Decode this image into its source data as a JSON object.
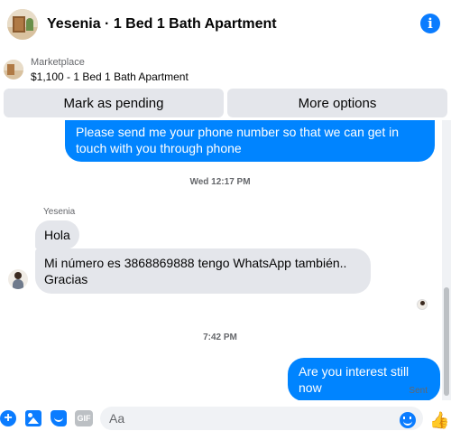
{
  "header": {
    "title": "Yesenia · 1 Bed 1 Bath Apartment",
    "info_icon": "info-icon",
    "accent": "#0a7cff"
  },
  "listing": {
    "category": "Marketplace",
    "price_title": "$1,100 - 1 Bed 1 Bath Apartment"
  },
  "actions": {
    "mark_pending": "Mark as pending",
    "more_options": "More options"
  },
  "messages": {
    "outgoing_1": "Please send me your phone  number so that we can get in touch with you through phone",
    "timestamp_1": "Wed 12:17 PM",
    "sender_name": "Yesenia",
    "incoming_1": "Hola",
    "incoming_2": "Mi número es 3868869888 tengo WhatsApp también.. Gracias",
    "timestamp_2": "7:42 PM",
    "outgoing_2": "Are you interest still now",
    "status": "Sent"
  },
  "composer": {
    "placeholder": "Aa",
    "icons": [
      "plus-icon",
      "image-icon",
      "sticker-icon",
      "gif-icon",
      "emoji-icon",
      "like-icon"
    ],
    "gif_label": "GIF",
    "like_glyph": "👍",
    "plus_glyph": "+"
  },
  "colors": {
    "outgoing_bubble": "#0084ff",
    "incoming_bubble": "#e4e6eb",
    "button_bg": "#e4e6eb"
  }
}
